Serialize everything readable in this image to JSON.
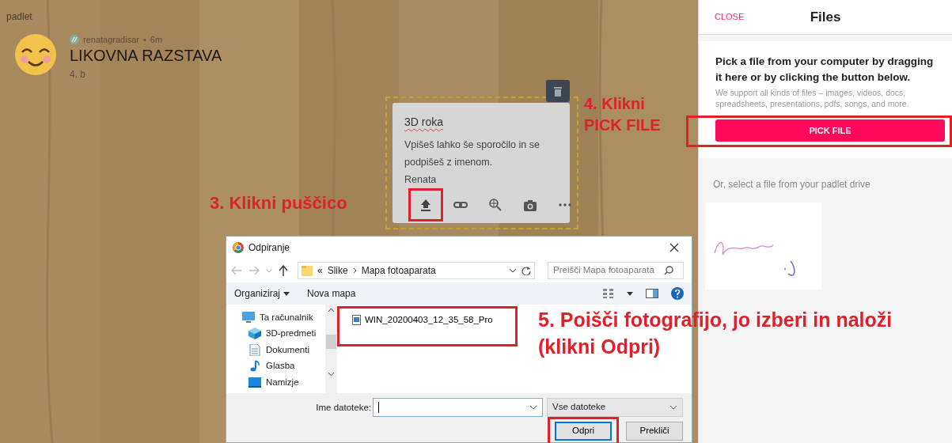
{
  "brand": "padlet",
  "wall": {
    "author": "renatagradisar",
    "separator": "•",
    "age": "6m",
    "title": "LIKOVNA RAZSTAVA",
    "subtitle": "4. b"
  },
  "post": {
    "title": "3D roka",
    "body": "Vpišeš lahko še sporočilo in se podpišeš z imenom.",
    "signature": "Renata",
    "tools": [
      {
        "kind": "upload",
        "highlighted": true
      },
      {
        "kind": "link",
        "highlighted": false
      },
      {
        "kind": "search",
        "highlighted": false
      },
      {
        "kind": "camera",
        "highlighted": false
      },
      {
        "kind": "more",
        "highlighted": false
      }
    ]
  },
  "files_panel": {
    "close": "CLOSE",
    "title": "Files",
    "heading": "Pick a file from your computer by dragging it here or by clicking the button below.",
    "note": "We support all kinds of files – images, videos, docs, spreadsheets, presentations, pdfs, songs, and more.",
    "button": "PICK FILE",
    "button_highlighted": true,
    "drive_label": "Or, select a file from your padlet drive"
  },
  "dialog": {
    "title": "Odpiranje",
    "path_overflow": "«",
    "path": [
      "Slike",
      "Mapa fotoaparata"
    ],
    "search_placeholder": "Preišči Mapa fotoaparata",
    "organize": "Organiziraj",
    "new_folder": "Nova mapa",
    "sidebar": [
      {
        "label": "Ta računalnik",
        "kind": "computer"
      },
      {
        "label": "3D-predmeti",
        "kind": "cube"
      },
      {
        "label": "Dokumenti",
        "kind": "document"
      },
      {
        "label": "Glasba",
        "kind": "music"
      },
      {
        "label": "Namizje",
        "kind": "desktop"
      }
    ],
    "files": [
      {
        "name": "WIN_20200403_12_35_58_Pro",
        "highlighted": true
      }
    ],
    "filename_label": "Ime datoteke:",
    "file_type": "Vse datoteke",
    "buttons": [
      {
        "label": "Odpri",
        "kind": "primary",
        "highlighted": true
      },
      {
        "label": "Prekliči",
        "kind": "secondary",
        "highlighted": false
      }
    ]
  },
  "annotations": [
    {
      "lines": [
        "3. Klikni puščico"
      ]
    },
    {
      "lines": [
        "4. Klikni",
        "PICK FILE"
      ]
    },
    {
      "lines": [
        "5. Poišči fotografijo, jo izberi in naloži",
        "(klikni Odpri)"
      ]
    }
  ]
}
